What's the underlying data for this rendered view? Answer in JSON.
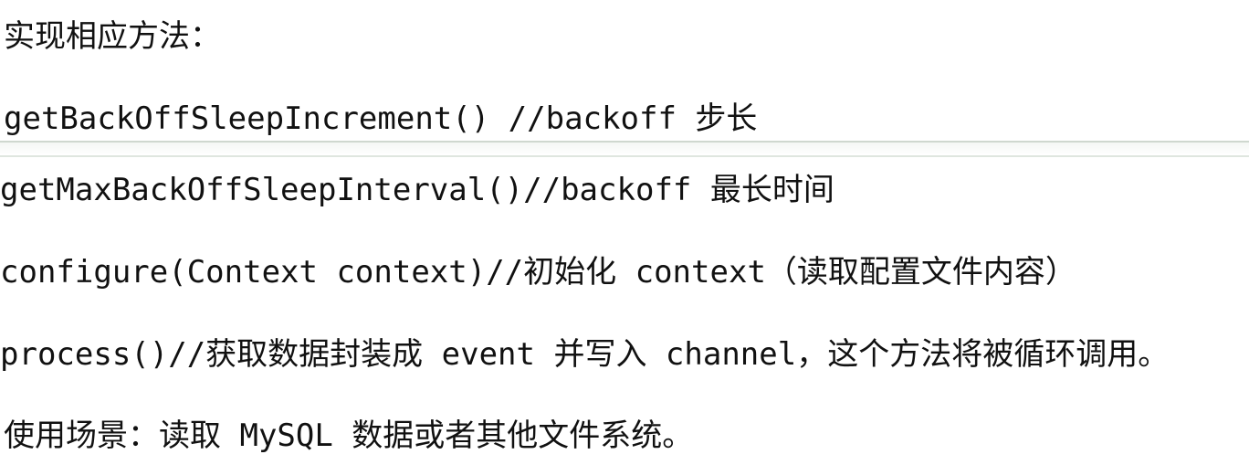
{
  "lines": [
    "实现相应方法：",
    "getBackOffSleepIncrement() //backoff 步长",
    "getMaxBackOffSleepInterval()//backoff 最长时间",
    "configure(Context context)//初始化 context（读取配置文件内容）",
    "process()//获取数据封装成 event 并写入 channel，这个方法将被循环调用。",
    "使用场景：读取 MySQL 数据或者其他文件系统。"
  ]
}
